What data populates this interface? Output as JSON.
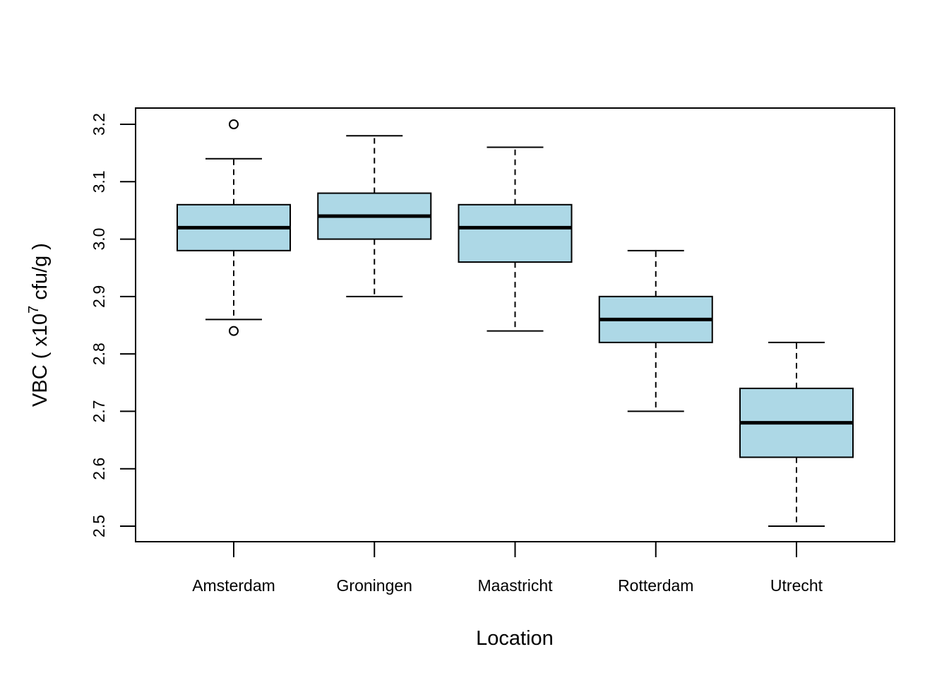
{
  "chart_data": {
    "type": "boxplot",
    "title": "",
    "xlabel": "Location",
    "ylabel": {
      "prefix": "VBC ( x10",
      "superscript": "7",
      "suffix": " cfu/g )"
    },
    "ylim": [
      2.48,
      3.22
    ],
    "yticks": [
      2.5,
      2.6,
      2.7,
      2.8,
      2.9,
      3.0,
      3.1,
      3.2
    ],
    "ytick_labels": [
      "2.5",
      "2.6",
      "2.7",
      "2.8",
      "2.9",
      "3.0",
      "3.1",
      "3.2"
    ],
    "categories": [
      "Amsterdam",
      "Groningen",
      "Maastricht",
      "Rotterdam",
      "Utrecht"
    ],
    "box_fill": "#add8e6",
    "grid": false,
    "legend": "none",
    "boxes": [
      {
        "name": "Amsterdam",
        "whisker_low": 2.86,
        "q1": 2.98,
        "median": 3.02,
        "q3": 3.06,
        "whisker_high": 3.14,
        "outliers": [
          3.2,
          2.84
        ]
      },
      {
        "name": "Groningen",
        "whisker_low": 2.9,
        "q1": 3.0,
        "median": 3.04,
        "q3": 3.08,
        "whisker_high": 3.18,
        "outliers": []
      },
      {
        "name": "Maastricht",
        "whisker_low": 2.84,
        "q1": 2.96,
        "median": 3.02,
        "q3": 3.06,
        "whisker_high": 3.16,
        "outliers": []
      },
      {
        "name": "Rotterdam",
        "whisker_low": 2.7,
        "q1": 2.82,
        "median": 2.86,
        "q3": 2.9,
        "whisker_high": 2.98,
        "outliers": []
      },
      {
        "name": "Utrecht",
        "whisker_low": 2.5,
        "q1": 2.62,
        "median": 2.68,
        "q3": 2.74,
        "whisker_high": 2.82,
        "outliers": []
      }
    ]
  }
}
